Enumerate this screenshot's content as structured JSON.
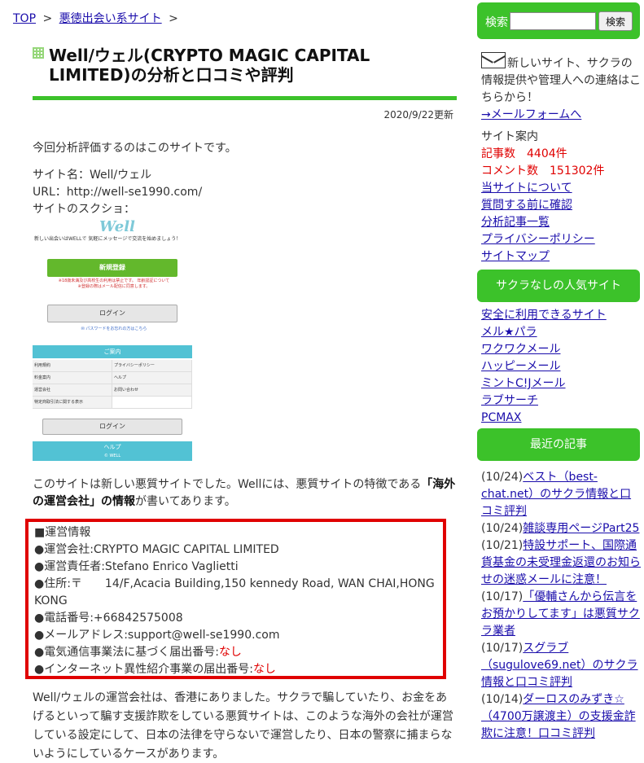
{
  "breadcrumb": {
    "top": "TOP",
    "category": "悪徳出会い系サイト",
    "sep": ">"
  },
  "article": {
    "title": "Well/ウェル(CRYPTO MAGIC CAPITAL LIMITED)の分析と口コミや評判",
    "updated": "2020/9/22更新",
    "intro": "今回分析評価するのはこのサイトです。",
    "site_name": "サイト名：Well/ウェル",
    "url": "URL：http://well-se1990.com/",
    "screenshot_label": "サイトのスクショ："
  },
  "screenshot": {
    "logo": "Well",
    "tagline": "新しい出会いはWELLで 気軽にメッセージで交流を始めましょう！",
    "register": "新規登録",
    "note": "※18歳未満及び高校生の利用は禁止です。 年齢認証について ※登録の際はメール配信に同意します。",
    "login": "ログイン",
    "password_link": "✉ パスワードをお忘れの方はこちら",
    "guide": "ご案内",
    "grid": [
      [
        "利用規約",
        "プライバシーポリシー"
      ],
      [
        "料金案内",
        "ヘルプ"
      ],
      [
        "運営会社",
        "お問い合わせ"
      ],
      [
        "特定商取引法に関する表示",
        ""
      ]
    ],
    "login2": "ログイン",
    "help": "ヘルプ",
    "help_sub": "© WELL"
  },
  "desc1": {
    "before": "このサイトは新しい悪質サイトでした。Wellには、悪質サイトの特徴である",
    "bold": "「海外の運営会社」の情報",
    "after": "が書いてあります。"
  },
  "operator": {
    "heading": "■運営情報",
    "company": "●運営会社:CRYPTO MAGIC CAPITAL LIMITED",
    "manager": "●運営責任者:Stefano Enrico Vaglietti",
    "address": "●住所:〒　　14/F,Acacia Building,150 kennedy Road, WAN CHAI,HONG KONG",
    "phone": "●電話番号:+66842575008",
    "email": "●メールアドレス:support@well-se1990.com",
    "telecom_label": "●電気通信事業法に基づく届出番号:",
    "telecom_value": "なし",
    "internet_label": "●インターネット異性紹介事業の届出番号:",
    "internet_value": "なし"
  },
  "desc2": "Well/ウェルの運営会社は、香港にありました。サクラで騙していたり、お金をあげるといって騙す支援詐欺をしている悪質サイトは、このような海外の会社が運営している設定にして、日本の法律を守らないで運営したり、日本の警察に捕まらないようにしているケースがあります。",
  "sidebar": {
    "search_label": "検索",
    "search_value": "",
    "search_button": "検索",
    "contact_text": "新しいサイト、サクラの情報提供や管理人への連絡はこちらから！",
    "contact_link": "→メールフォームへ",
    "guide_label": "サイト案内",
    "article_count": "記事数　4404件",
    "comment_count": "コメント数　151302件",
    "links": [
      "当サイトについて",
      "質問する前に確認",
      "分析記事一覧",
      "プライバシーポリシー",
      "サイトマップ"
    ],
    "popular_heading": "サクラなしの人気サイト",
    "popular": [
      "安全に利用できるサイト",
      "メル★パラ",
      "ワクワクメール",
      "ハッピーメール",
      "ミントC!Jメール",
      "ラブサーチ",
      "PCMAX"
    ],
    "recent_heading": "最近の記事",
    "recent": [
      {
        "date": "(10/24)",
        "title": "ベスト（best-chat.net）のサクラ情報と口コミ評判"
      },
      {
        "date": "(10/24)",
        "title": "雑談専用ページPart25"
      },
      {
        "date": "(10/21)",
        "title": "特設サポート、国際通貨基金の未受理金返還のお知らせの迷惑メールに注意！"
      },
      {
        "date": "(10/17)",
        "title": "「優輔さんから伝言をお預かりしてます」は悪質サクラ業者"
      },
      {
        "date": "(10/17)",
        "title": "スグラブ（sugulove69.net）のサクラ情報と口コミ評判"
      },
      {
        "date": "(10/14)",
        "title": "ダーロスのみずき☆（4700万譲渡主）の支援金詐欺に注意！口コミ評判"
      }
    ]
  }
}
